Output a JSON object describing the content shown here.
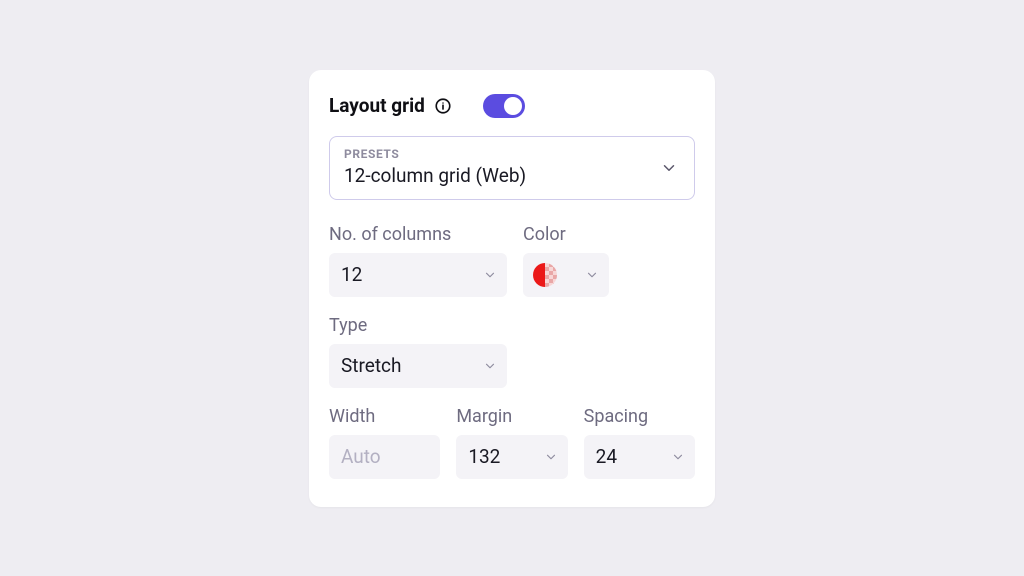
{
  "panel": {
    "title": "Layout grid",
    "toggle_on": true
  },
  "preset": {
    "label": "PRESETS",
    "value": "12-column grid (Web)"
  },
  "fields": {
    "columns": {
      "label": "No. of columns",
      "value": "12"
    },
    "color": {
      "label": "Color",
      "hex": "#EB1818"
    },
    "type": {
      "label": "Type",
      "value": "Stretch"
    },
    "width": {
      "label": "Width",
      "value": "Auto",
      "disabled": true
    },
    "margin": {
      "label": "Margin",
      "value": "132"
    },
    "spacing": {
      "label": "Spacing",
      "value": "24"
    }
  }
}
